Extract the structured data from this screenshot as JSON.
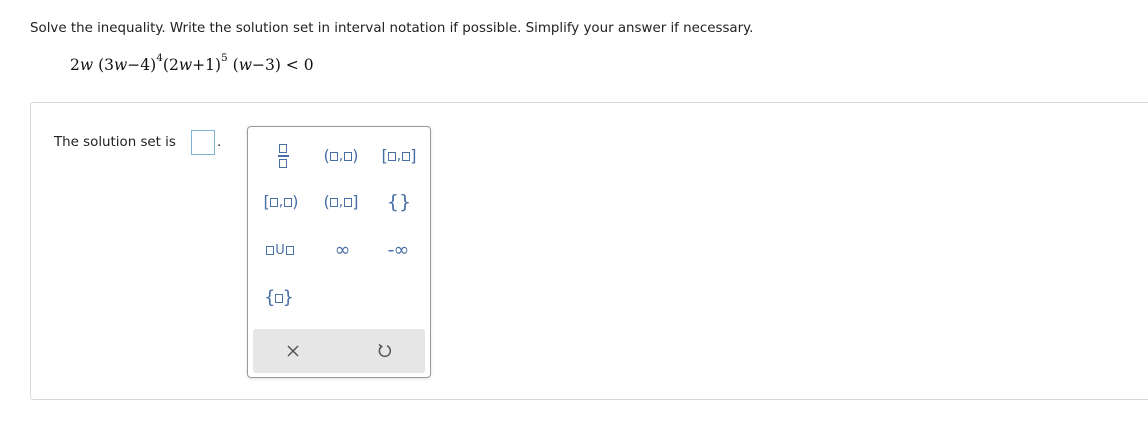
{
  "question": {
    "instructions": "Solve the inequality. Write the solution set in interval notation if possible. Simplify your answer if necessary."
  },
  "equation": {
    "lead": "2",
    "var1": "w",
    "open1": "(3",
    "var2": "w",
    "tail1": "−4)",
    "exp1": "4",
    "open2": "(2",
    "var3": "w",
    "tail2": "+1)",
    "exp2": "5",
    "open3": "(",
    "var4": "w",
    "tail3": "−3) < 0"
  },
  "answer": {
    "prompt": "The solution set is",
    "period": ".",
    "value": ""
  },
  "palette": {
    "comma": ",",
    "union": "U",
    "infinity": "∞",
    "neg_infinity": "-∞",
    "open_paren": "(",
    "close_paren": ")",
    "open_bracket": "[",
    "close_bracket": "]",
    "open_brace": "{",
    "close_brace": "}"
  },
  "colors": {
    "accent": "#4a6fa5",
    "input_border": "#7fb3d5",
    "panel_border": "#d9d9d9",
    "bottom_bar": "#e6e6e6"
  },
  "icons": {
    "clear": "close-icon",
    "undo": "undo-icon"
  }
}
